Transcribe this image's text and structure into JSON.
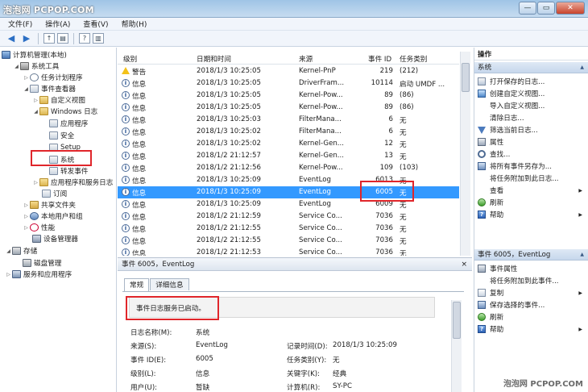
{
  "watermark": {
    "top": "泡泡网 PCPOP.COM",
    "bottom": "泡泡网 PCPOP.COM"
  },
  "window": {
    "min": "—",
    "max": "▭",
    "close": "✕"
  },
  "menu": [
    "文件(F)",
    "操作(A)",
    "查看(V)",
    "帮助(H)"
  ],
  "tree": {
    "root": "计算机管理(本地)",
    "system_tools": "系统工具",
    "task_scheduler": "任务计划程序",
    "event_viewer": "事件查看器",
    "custom_views": "自定义视图",
    "windows_logs": "Windows 日志",
    "application": "应用程序",
    "security": "安全",
    "setup": "Setup",
    "system": "系统",
    "forwarded": "转发事件",
    "apps_services": "应用程序和服务日志",
    "subscriptions": "订阅",
    "shared_folders": "共享文件夹",
    "local_users": "本地用户和组",
    "performance": "性能",
    "device_manager": "设备管理器",
    "storage": "存储",
    "disk_mgmt": "磁盘管理",
    "services_apps": "服务和应用程序"
  },
  "list": {
    "columns": [
      "级别",
      "日期和时间",
      "来源",
      "事件 ID",
      "任务类别"
    ],
    "rows": [
      {
        "level": "警告",
        "icon": "warn",
        "time": "2018/1/3 10:25:05",
        "source": "Kernel-PnP",
        "id": "219",
        "task": "(212)"
      },
      {
        "level": "信息",
        "icon": "info",
        "time": "2018/1/3 10:25:05",
        "source": "DriverFram...",
        "id": "10114",
        "task": "启动 UMDF ..."
      },
      {
        "level": "信息",
        "icon": "info",
        "time": "2018/1/3 10:25:05",
        "source": "Kernel-Pow...",
        "id": "89",
        "task": "(86)"
      },
      {
        "level": "信息",
        "icon": "info",
        "time": "2018/1/3 10:25:05",
        "source": "Kernel-Pow...",
        "id": "89",
        "task": "(86)"
      },
      {
        "level": "信息",
        "icon": "info",
        "time": "2018/1/3 10:25:03",
        "source": "FilterMana...",
        "id": "6",
        "task": "无"
      },
      {
        "level": "信息",
        "icon": "info",
        "time": "2018/1/3 10:25:02",
        "source": "FilterMana...",
        "id": "6",
        "task": "无"
      },
      {
        "level": "信息",
        "icon": "info",
        "time": "2018/1/3 10:25:02",
        "source": "Kernel-Gen...",
        "id": "12",
        "task": "无"
      },
      {
        "level": "信息",
        "icon": "info",
        "time": "2018/1/2 21:12:57",
        "source": "Kernel-Gen...",
        "id": "13",
        "task": "无"
      },
      {
        "level": "信息",
        "icon": "info",
        "time": "2018/1/2 21:12:56",
        "source": "Kernel-Pow...",
        "id": "109",
        "task": "(103)"
      },
      {
        "level": "信息",
        "icon": "info",
        "time": "2018/1/3 10:25:09",
        "source": "EventLog",
        "id": "6013",
        "task": "无"
      },
      {
        "level": "信息",
        "icon": "info",
        "time": "2018/1/3 10:25:09",
        "source": "EventLog",
        "id": "6005",
        "task": "无",
        "selected": true
      },
      {
        "level": "信息",
        "icon": "info",
        "time": "2018/1/3 10:25:09",
        "source": "EventLog",
        "id": "6009",
        "task": "无"
      },
      {
        "level": "信息",
        "icon": "info",
        "time": "2018/1/2 21:12:59",
        "source": "Service Co...",
        "id": "7036",
        "task": "无"
      },
      {
        "level": "信息",
        "icon": "info",
        "time": "2018/1/2 21:12:55",
        "source": "Service Co...",
        "id": "7036",
        "task": "无"
      },
      {
        "level": "信息",
        "icon": "info",
        "time": "2018/1/2 21:12:55",
        "source": "Service Co...",
        "id": "7036",
        "task": "无"
      },
      {
        "level": "信息",
        "icon": "info",
        "time": "2018/1/2 21:12:53",
        "source": "Service Co...",
        "id": "7036",
        "task": "无"
      }
    ]
  },
  "detail": {
    "title": "事件 6005，EventLog",
    "close": "×",
    "tabs": [
      "常规",
      "详细信息"
    ],
    "message": "事件日志服务已启动。",
    "fields": {
      "log_name_label": "日志名称(M):",
      "log_name": "系统",
      "source_label": "来源(S):",
      "source": "EventLog",
      "recorded_label": "记录时间(D):",
      "recorded": "2018/1/3 10:25:09",
      "event_id_label": "事件 ID(E):",
      "event_id": "6005",
      "task_label": "任务类别(Y):",
      "task": "无",
      "level_label": "级别(L):",
      "level": "信息",
      "keywords_label": "关键字(K):",
      "keywords": "经典",
      "user_label": "用户(U):",
      "user": "暂缺",
      "computer_label": "计算机(R):",
      "computer": "SY-PC"
    }
  },
  "actions": {
    "header": "操作",
    "section1": "系统",
    "items1": [
      "打开保存的日志...",
      "创建自定义视图...",
      "导入自定义视图...",
      "清除日志...",
      "筛选当前日志...",
      "属性",
      "查找...",
      "将所有事件另存为...",
      "将任务附加到此日志...",
      "查看",
      "刷新",
      "帮助"
    ],
    "section2": "事件 6005，EventLog",
    "items2": [
      "事件属性",
      "将任务附加到此事件...",
      "复制",
      "保存选择的事件...",
      "刷新",
      "帮助"
    ]
  }
}
